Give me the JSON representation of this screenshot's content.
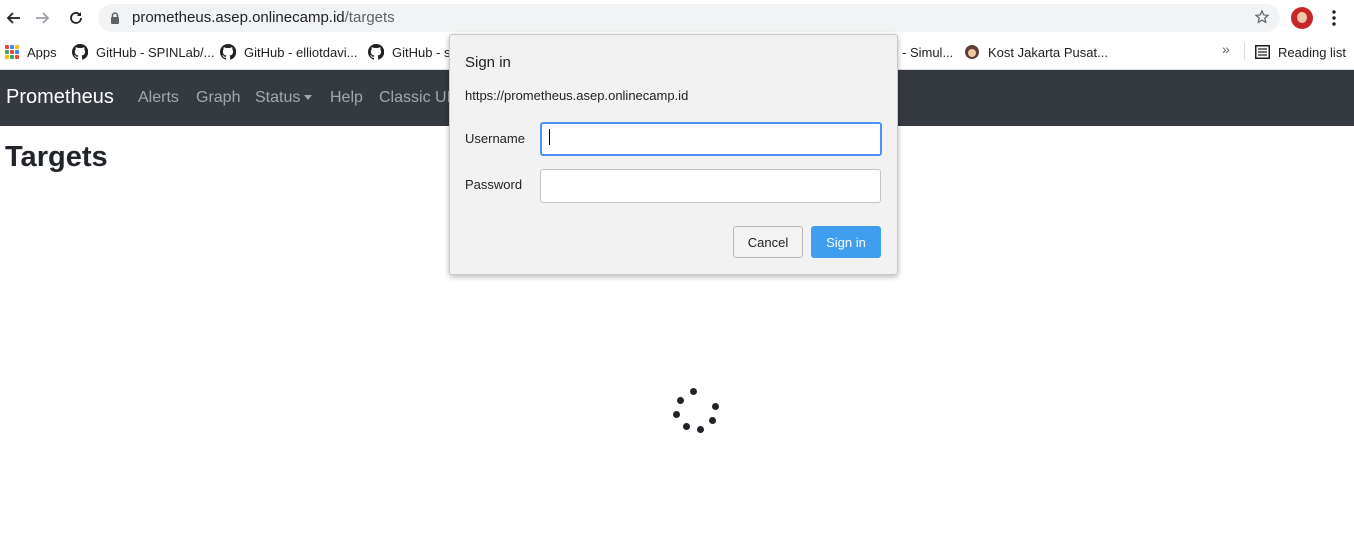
{
  "browser": {
    "url_host": "prometheus.asep.onlinecamp.id",
    "url_path": "/targets"
  },
  "bookmarks": {
    "apps_label": "Apps",
    "items": [
      {
        "label": "GitHub - SPINLab/...",
        "icon": "github-icon"
      },
      {
        "label": "GitHub - elliotdavi...",
        "icon": "github-icon"
      },
      {
        "label": "GitHub - sa",
        "icon": "github-icon"
      },
      {
        "label": "- Simul...",
        "icon": ""
      },
      {
        "label": "Kost Jakarta Pusat...",
        "icon": "kost-favicon-icon"
      }
    ],
    "reading_list": "Reading list"
  },
  "app": {
    "brand": "Prometheus",
    "nav": [
      "Alerts",
      "Graph",
      "Status",
      "Help",
      "Classic UI"
    ],
    "page_title": "Targets"
  },
  "dialog": {
    "title": "Sign in",
    "origin": "https://prometheus.asep.onlinecamp.id",
    "username_label": "Username",
    "username_value": "",
    "password_label": "Password",
    "password_value": "",
    "cancel_label": "Cancel",
    "signin_label": "Sign in"
  },
  "colors": {
    "navbar_bg": "#343a40",
    "signin_button": "#3f9eee",
    "focus_ring": "#4d90fe"
  }
}
